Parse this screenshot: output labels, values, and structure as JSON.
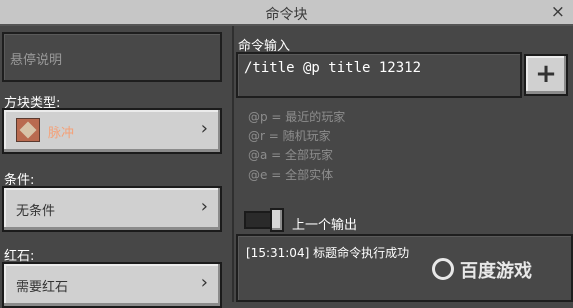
{
  "window": {
    "title": "命令块",
    "close_label": "×"
  },
  "left": {
    "hover_note_placeholder": "悬停说明",
    "block_type": {
      "label": "方块类型:",
      "value": "脉冲"
    },
    "condition": {
      "label": "条件:",
      "value": "无条件"
    },
    "redstone": {
      "label": "红石:",
      "value": "需要红石"
    },
    "chevron": "›"
  },
  "right": {
    "command_label": "命令输入",
    "command_value": "/title @p title 12312",
    "plus_label": "+",
    "hints": [
      "@p = 最近的玩家",
      "@r = 随机玩家",
      "@a = 全部玩家",
      "@e = 全部实体"
    ],
    "previous_output_label": "上一个输出",
    "output_text": "[15:31:04] 标题命令执行成功"
  },
  "watermark": {
    "text": "百度游戏"
  },
  "colors": {
    "background": "#474747",
    "titlebar": "#c6c6c6",
    "button": "#d0d0d0",
    "pulse_accent": "#f4a178"
  }
}
